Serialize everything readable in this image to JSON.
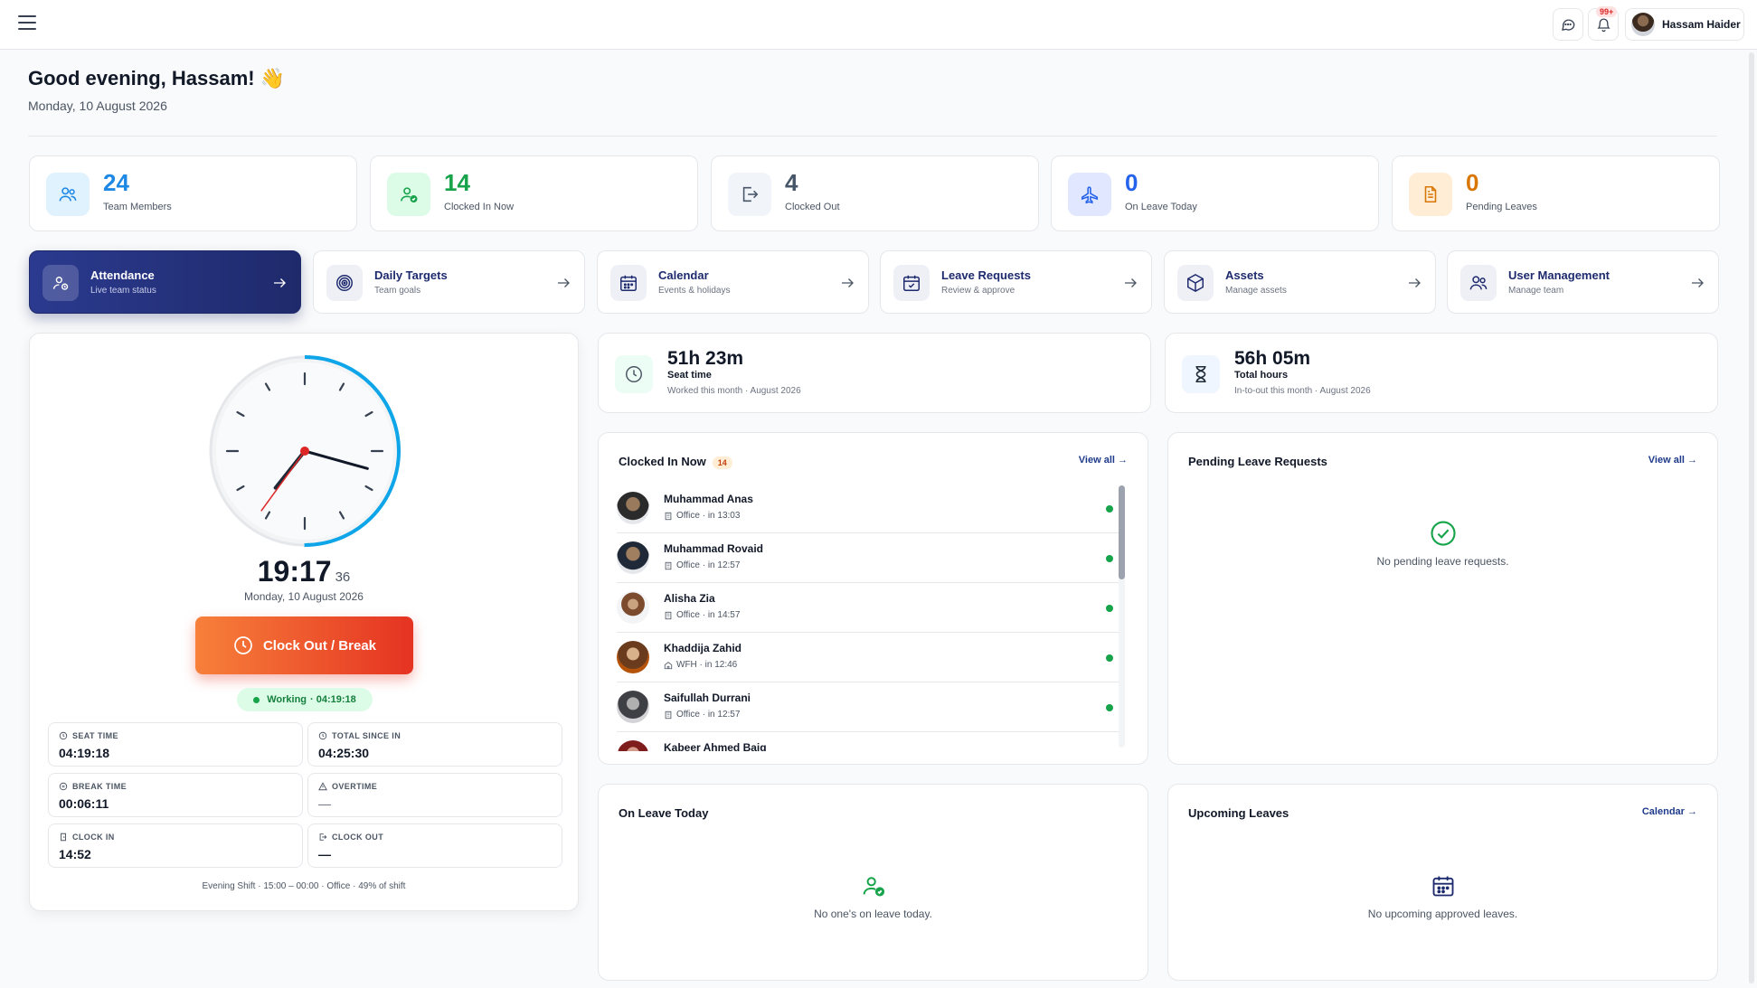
{
  "user": {
    "name": "Hassam Haider"
  },
  "notifications": {
    "badge": "99+"
  },
  "greeting": "Good evening, Hassam! 👋",
  "today": "Monday, 10 August 2026",
  "stats": [
    {
      "value": "24",
      "label": "Team Members",
      "color": "#1e88e5",
      "bg": "#e0f2fe"
    },
    {
      "value": "14",
      "label": "Clocked In Now",
      "color": "#16a34a",
      "bg": "#dcfce7"
    },
    {
      "value": "4",
      "label": "Clocked Out",
      "color": "#475569",
      "bg": "#f1f5f9"
    },
    {
      "value": "0",
      "label": "On Leave Today",
      "color": "#2563eb",
      "bg": "#e0e7ff"
    },
    {
      "value": "0",
      "label": "Pending Leaves",
      "color": "#d97706",
      "bg": "#ffedd5"
    }
  ],
  "nav": [
    {
      "title": "Attendance",
      "sub": "Live team status"
    },
    {
      "title": "Daily Targets",
      "sub": "Team goals"
    },
    {
      "title": "Calendar",
      "sub": "Events & holidays"
    },
    {
      "title": "Leave Requests",
      "sub": "Review & approve"
    },
    {
      "title": "Assets",
      "sub": "Manage assets"
    },
    {
      "title": "User Management",
      "sub": "Manage team"
    }
  ],
  "clock": {
    "time": "19:17",
    "seconds": "36",
    "date": "Monday, 10 August 2026",
    "button": "Clock Out / Break",
    "status": "Working",
    "status_time": "· 04:19:18",
    "stats": [
      {
        "label": "SEAT TIME",
        "value": "04:19:18"
      },
      {
        "label": "TOTAL SINCE IN",
        "value": "04:25:30"
      },
      {
        "label": "BREAK TIME",
        "value": "00:06:11"
      },
      {
        "label": "OVERTIME",
        "value": "—"
      },
      {
        "label": "CLOCK IN",
        "value": "14:52"
      },
      {
        "label": "CLOCK OUT",
        "value": "—"
      }
    ],
    "footer": "Evening Shift · 15:00 – 00:00 · Office · 49% of shift",
    "accent": "#0ea5e9"
  },
  "metrics": [
    {
      "value": "51h 23m",
      "label": "Seat time",
      "sub": "Worked this month · August 2026"
    },
    {
      "value": "56h 05m",
      "label": "Total hours",
      "sub": "In-to-out this month · August 2026"
    }
  ],
  "clocked_in": {
    "title": "Clocked In Now",
    "count": "14",
    "link": "View all →",
    "people": [
      {
        "name": "Muhammad Anas",
        "status": "Office · in 13:03",
        "mode": "office"
      },
      {
        "name": "Muhammad Rovaid",
        "status": "Office · in 12:57",
        "mode": "office"
      },
      {
        "name": "Alisha Zia",
        "status": "Office · in 14:57",
        "mode": "office"
      },
      {
        "name": "Khaddija Zahid",
        "status": "WFH · in 12:46",
        "mode": "wfh"
      },
      {
        "name": "Saifullah Durrani",
        "status": "Office · in 12:57",
        "mode": "office"
      },
      {
        "name": "Kabeer Ahmed Baig",
        "status": "",
        "mode": "office"
      }
    ]
  },
  "pending": {
    "title": "Pending Leave Requests",
    "link": "View all →",
    "empty": "No pending leave requests."
  },
  "on_leave": {
    "title": "On Leave Today",
    "empty": "No one's on leave today."
  },
  "upcoming": {
    "title": "Upcoming Leaves",
    "link": "Calendar →",
    "empty": "No upcoming approved leaves."
  }
}
